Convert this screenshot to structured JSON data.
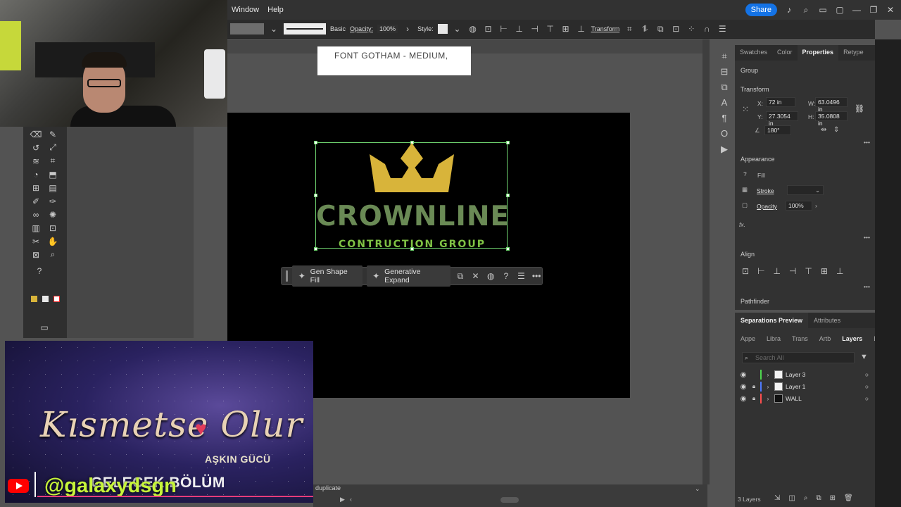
{
  "menu": {
    "window": "Window",
    "help": "Help",
    "share": "Share"
  },
  "control_bar": {
    "stroke_style": "Basic",
    "opacity_label": "Opacity:",
    "opacity_value": "100%",
    "style_label": "Style:",
    "transform_label": "Transform"
  },
  "note": {
    "text": "FONT GOTHAM - MEDIUM,"
  },
  "logo": {
    "title": "CROWNLINE",
    "subtitle": "CONTRUCTION GROUP",
    "crown_color": "#d8b43a",
    "title_color": "#6a8a55",
    "subtitle_color": "#7fc244"
  },
  "taskbar": {
    "gen_shape_fill": "Gen Shape Fill",
    "generative_expand": "Generative Expand",
    "help": "?"
  },
  "status": {
    "text": "duplicate"
  },
  "banner": {
    "title": "Kısmetse Olur",
    "subtitle": "AŞKIN GÜCÜ",
    "next": "GELECEK BÖLÜM",
    "handle": "@galaxydsgn"
  },
  "properties": {
    "tabs": [
      "Swatches",
      "Color",
      "Properties",
      "Retype"
    ],
    "active_tab": "Properties",
    "group_label": "Group",
    "transform_label": "Transform",
    "x_label": "X:",
    "x_value": "72 in",
    "y_label": "Y:",
    "y_value": "27.3054 in",
    "w_label": "W:",
    "w_value": "63.0496 in",
    "h_label": "H:",
    "h_value": "35.0808 in",
    "angle_value": "180°",
    "appearance_label": "Appearance",
    "fill_label": "Fill",
    "stroke_label": "Stroke",
    "opacity_label": "Opacity",
    "opacity_value": "100%",
    "fx_label": "fx.",
    "align_label": "Align",
    "pathfinder_label": "Pathfinder"
  },
  "layers_panel": {
    "top_tabs": [
      "Separations Preview",
      "Attributes"
    ],
    "tabs": [
      "Appe",
      "Libra",
      "Trans",
      "Artb",
      "Layers",
      "Links"
    ],
    "active_tab": "Layers",
    "search_placeholder": "Search All",
    "layers": [
      {
        "name": "Layer 3",
        "color": "#4fd84f",
        "locked": false
      },
      {
        "name": "Layer 1",
        "color": "#4f7bff",
        "locked": true
      },
      {
        "name": "WALL",
        "color": "#ff4f4f",
        "locked": true
      }
    ],
    "footer": "3 Layers"
  }
}
